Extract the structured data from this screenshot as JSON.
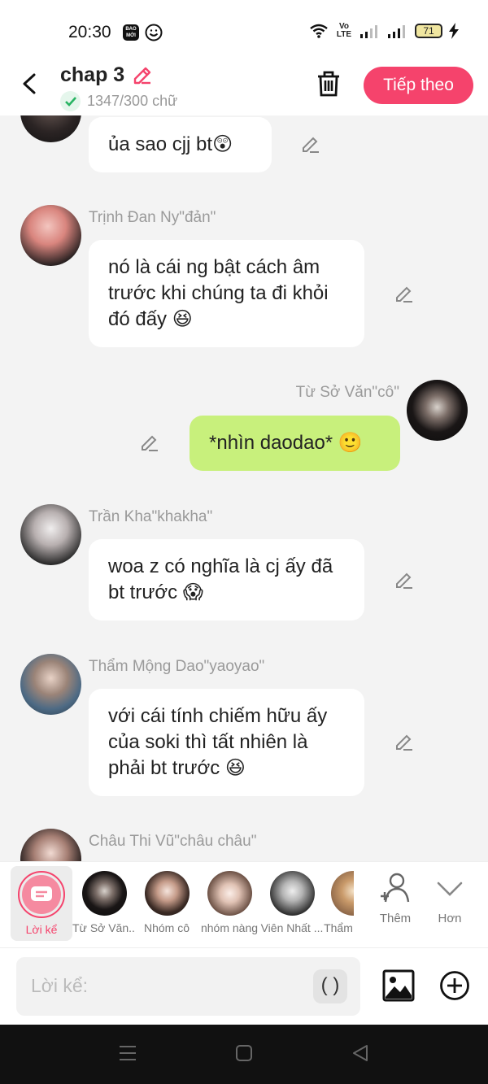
{
  "status_bar": {
    "time": "20:30",
    "baomoi_label": "BAO MỚI",
    "volte_label": "Vo LTE",
    "battery": "71"
  },
  "header": {
    "title": "chap 3",
    "word_count": "1347/300 chữ",
    "next_label": "Tiếp theo"
  },
  "messages": [
    {
      "sender": "",
      "text": "ủa sao cjj bt😲",
      "side": "left"
    },
    {
      "sender": "Trịnh Đan Ny\"đản\"",
      "text": "nó là cái ng bật cách âm trước khi chúng ta đi khỏi đó đấy 😆",
      "side": "left"
    },
    {
      "sender": "Từ Sở Văn\"cô\"",
      "text": "*nhìn daodao* 🙂",
      "side": "right"
    },
    {
      "sender": "Trần Kha\"khakha\"",
      "text": "woa z có nghĩa là cj ấy đã bt trước 😱",
      "side": "left"
    },
    {
      "sender": "Thẩm Mộng Dao\"yaoyao\"",
      "text": "với cái tính chiếm hữu ấy của soki thì tất nhiên là phải bt trước 😆",
      "side": "left"
    },
    {
      "sender": "Châu Thi Vũ\"châu châu\"",
      "text": "",
      "side": "left"
    }
  ],
  "characters": {
    "narrator": "Lời kể",
    "items": [
      "Từ Sở Văn...",
      "Nhóm cô",
      "nhóm nàng",
      "Viên Nhất ...",
      "Thẩm"
    ],
    "add_label": "Thêm",
    "more_label": "Hơn"
  },
  "composer": {
    "placeholder": "Lời kể:",
    "paren": "( )"
  },
  "colors": {
    "accent": "#f5436c",
    "my_bubble": "#c8f07c",
    "background": "#f3f3f3"
  }
}
